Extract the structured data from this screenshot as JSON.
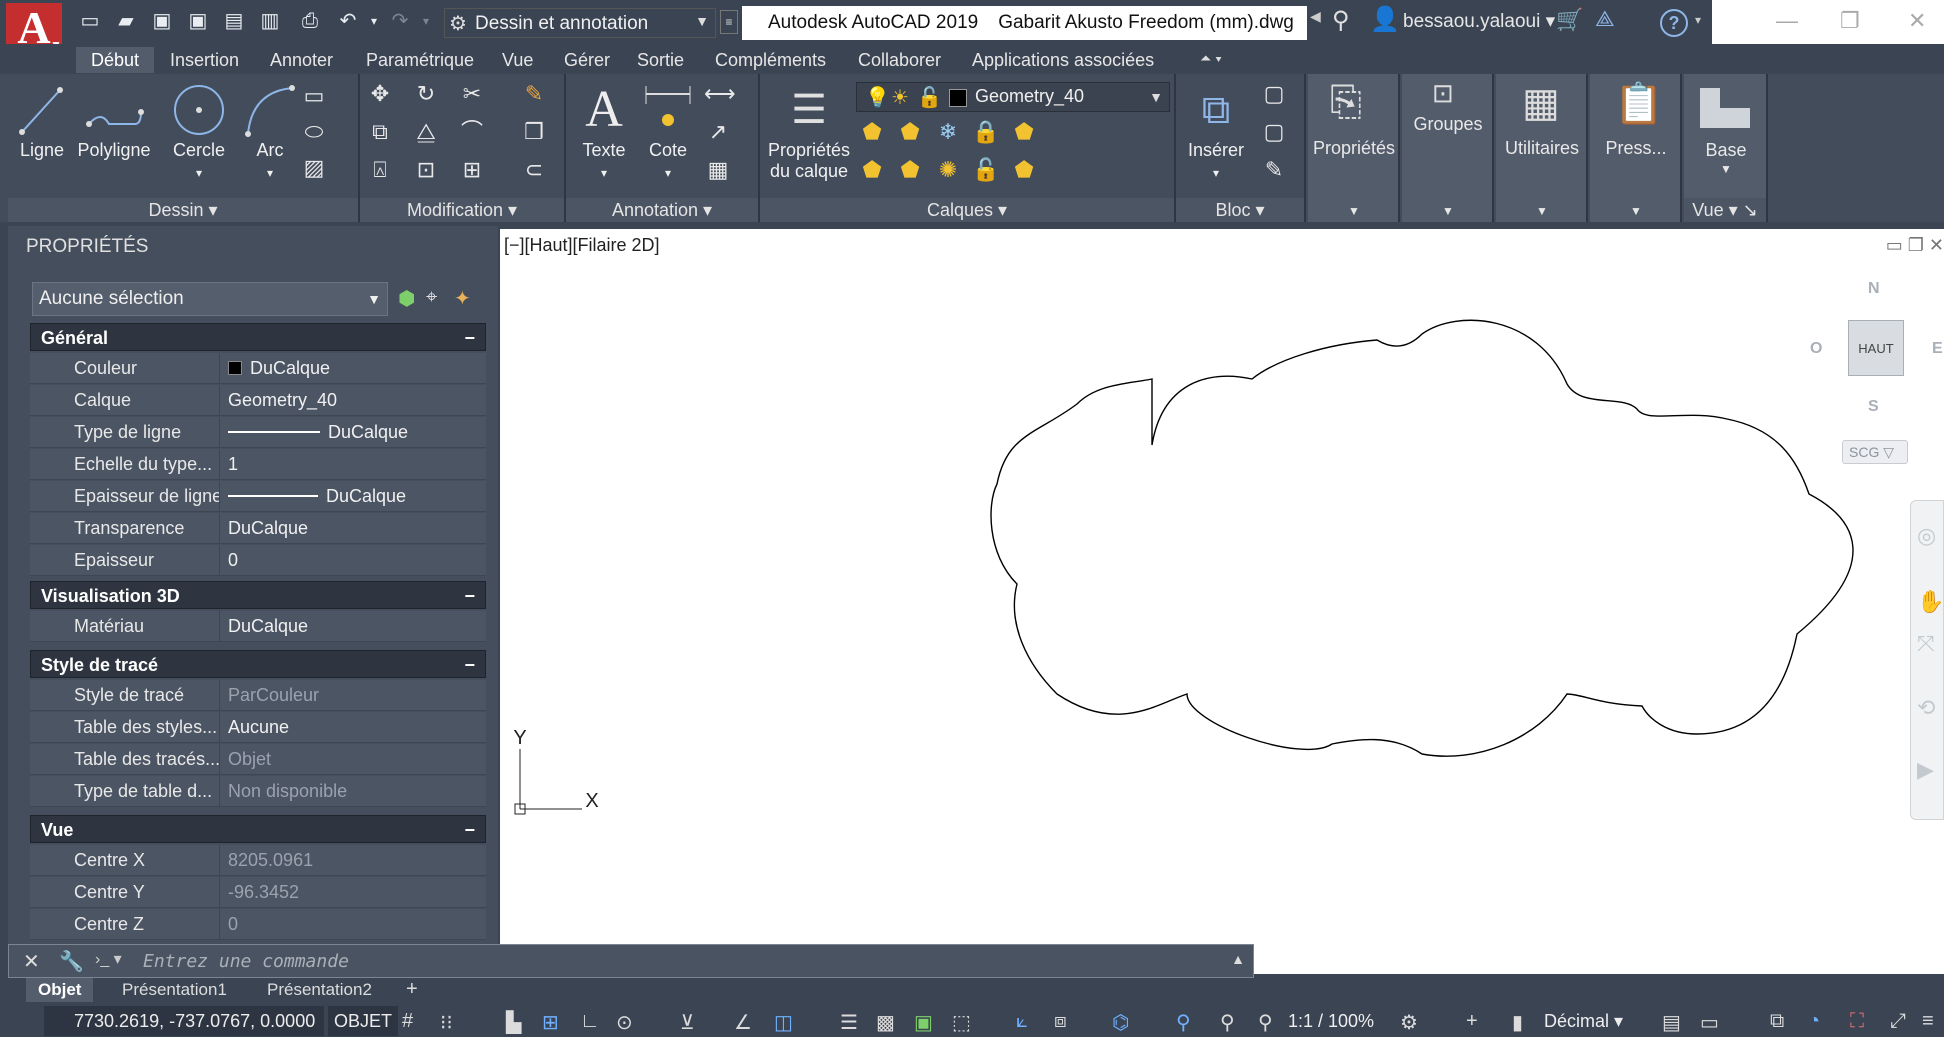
{
  "titlebar": {
    "workspace": "Dessin et annotation",
    "app_version": "Autodesk AutoCAD 2019",
    "document": "Gabarit Akusto Freedom (mm).dwg",
    "user": "bessaou.yalaoui",
    "logo_letter": "A"
  },
  "ribbon_tabs": [
    "Début",
    "Insertion",
    "Annoter",
    "Paramétrique",
    "Vue",
    "Gérer",
    "Sortie",
    "Compléments",
    "Collaborer",
    "Applications associées"
  ],
  "ribbon": {
    "dessin": {
      "title": "Dessin",
      "ligne": "Ligne",
      "polyligne": "Polyligne",
      "cercle": "Cercle",
      "arc": "Arc"
    },
    "modification": {
      "title": "Modification"
    },
    "annotation": {
      "title": "Annotation",
      "texte": "Texte",
      "cote": "Cote"
    },
    "calques": {
      "title": "Calques",
      "props_line1": "Propriétés",
      "props_line2": "du calque",
      "current_layer": "Geometry_40"
    },
    "bloc": {
      "title": "Bloc",
      "inserer": "Insérer"
    },
    "proprietes": "Propriétés",
    "groupes": "Groupes",
    "utilitaires": "Utilitaires",
    "presse": "Press...",
    "base": "Base",
    "vue": "Vue"
  },
  "properties_palette": {
    "title": "PROPRIÉTÉS",
    "selection": "Aucune sélection",
    "general": {
      "title": "Général",
      "couleur": {
        "label": "Couleur",
        "value": "DuCalque"
      },
      "calque": {
        "label": "Calque",
        "value": "Geometry_40"
      },
      "type_ligne": {
        "label": "Type de ligne",
        "value": "DuCalque"
      },
      "echelle": {
        "label": "Echelle du type...",
        "value": "1"
      },
      "epaisseur_ligne": {
        "label": "Epaisseur de ligne",
        "value": "DuCalque"
      },
      "transparence": {
        "label": "Transparence",
        "value": "DuCalque"
      },
      "epaisseur": {
        "label": "Epaisseur",
        "value": "0"
      }
    },
    "visu3d": {
      "title": "Visualisation 3D",
      "materiau": {
        "label": "Matériau",
        "value": "DuCalque"
      }
    },
    "style_trace": {
      "title": "Style de tracé",
      "style": {
        "label": "Style de tracé",
        "value": "ParCouleur"
      },
      "table_styles": {
        "label": "Table des styles...",
        "value": "Aucune"
      },
      "table_traces": {
        "label": "Table des tracés...",
        "value": "Objet"
      },
      "type_table": {
        "label": "Type de table d...",
        "value": "Non disponible"
      }
    },
    "vue": {
      "title": "Vue",
      "cx": {
        "label": "Centre X",
        "value": "8205.0961"
      },
      "cy": {
        "label": "Centre Y",
        "value": "-96.3452"
      },
      "cz": {
        "label": "Centre Z",
        "value": "0"
      }
    },
    "collapse_symbol": "−"
  },
  "viewport": {
    "label": "[−][Haut][Filaire 2D]",
    "viewcube_face": "HAUT",
    "compass": {
      "n": "N",
      "s": "S",
      "e": "E",
      "w": "O"
    },
    "ucs_menu": "SCG",
    "axis_y": "Y",
    "axis_x": "X"
  },
  "command_line": {
    "placeholder": "Entrez une commande"
  },
  "layout_tabs": [
    "Objet",
    "Présentation1",
    "Présentation2"
  ],
  "statusbar": {
    "coords": "7730.2619, -737.0767, 0.0000",
    "mode": "OBJET",
    "scale": "1:1 / 100%",
    "units": "Décimal"
  }
}
